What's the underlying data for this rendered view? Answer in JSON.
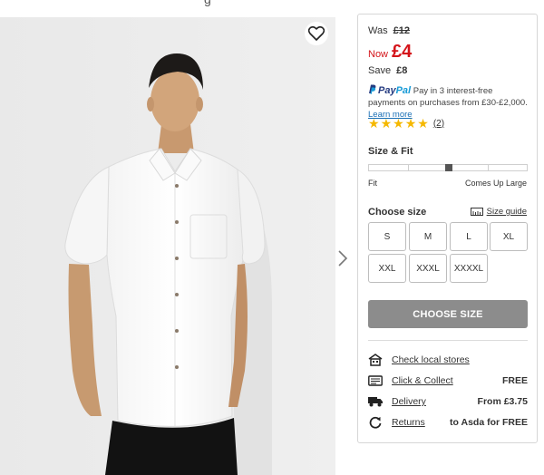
{
  "header": {
    "sliver_text": "g"
  },
  "product": {
    "image_alt": "Man wearing white short sleeve linen shirt",
    "wishlist_icon": "heart-icon",
    "next_icon": "chevron-right-icon"
  },
  "pricing": {
    "was_label": "Was",
    "was_price": "£12",
    "now_label": "Now",
    "now_price": "£4",
    "save_label": "Save",
    "save_amount": "£8",
    "price_color": "#d4141a"
  },
  "paypal": {
    "brand_a": "Pay",
    "brand_b": "Pal",
    "text": "Pay in 3 interest-free payments on purchases from £30-£2,000.",
    "learn_more": "Learn more"
  },
  "rating": {
    "stars": 5,
    "max_stars": 5,
    "review_count": "(2)"
  },
  "fit": {
    "title": "Size & Fit",
    "left_label": "Fit",
    "right_label": "Comes Up Large",
    "level": 0.5
  },
  "sizes": {
    "title": "Choose size",
    "guide_label": "Size guide",
    "options": [
      "S",
      "M",
      "L",
      "XL",
      "XXL",
      "XXXL",
      "XXXXL"
    ]
  },
  "cta": {
    "label": "CHOOSE SIZE"
  },
  "services": [
    {
      "icon": "store-icon",
      "label": "Check local stores",
      "value": ""
    },
    {
      "icon": "click-collect-icon",
      "label": "Click & Collect",
      "value": "FREE"
    },
    {
      "icon": "delivery-truck-icon",
      "label": "Delivery",
      "value": "From £3.75"
    },
    {
      "icon": "returns-icon",
      "label": "Returns",
      "value": "to Asda for FREE"
    }
  ]
}
